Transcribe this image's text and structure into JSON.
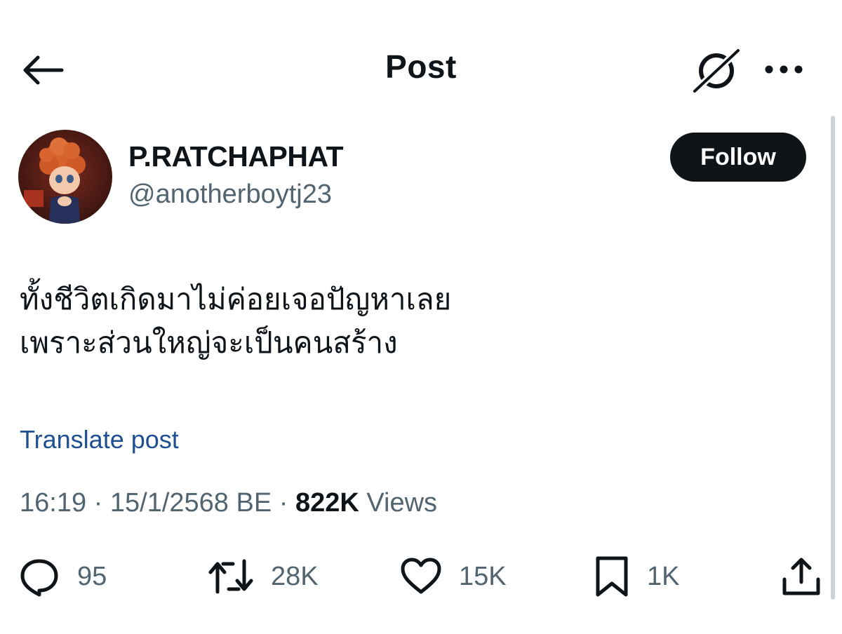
{
  "header": {
    "title": "Post",
    "back_icon": "arrow-left-icon",
    "grok_icon": "grok-icon",
    "more_icon": "more-horizontal-icon"
  },
  "author": {
    "display_name": "P.RATCHAPHAT",
    "handle": "@anotherboytj23",
    "follow_label": "Follow"
  },
  "post": {
    "lines": [
      "ทั้งชีวิตเกิดมาไม่ค่อยเจอปัญหาเลย",
      "เพราะส่วนใหญ่จะเป็นคนสร้าง"
    ],
    "translate_label": "Translate post"
  },
  "meta": {
    "time": "16:19",
    "separator": "·",
    "date": "15/1/2568 BE",
    "views_count": "822K",
    "views_label": "Views"
  },
  "actions": {
    "reply": {
      "icon": "reply-icon",
      "count": "95"
    },
    "repost": {
      "icon": "repost-icon",
      "count": "28K"
    },
    "like": {
      "icon": "heart-icon",
      "count": "15K"
    },
    "bookmark": {
      "icon": "bookmark-icon",
      "count": "1K"
    },
    "share": {
      "icon": "share-icon"
    }
  },
  "colors": {
    "text_primary": "#0f1419",
    "text_secondary": "#536471",
    "link": "#1d4f91",
    "follow_bg": "#0f1419"
  }
}
